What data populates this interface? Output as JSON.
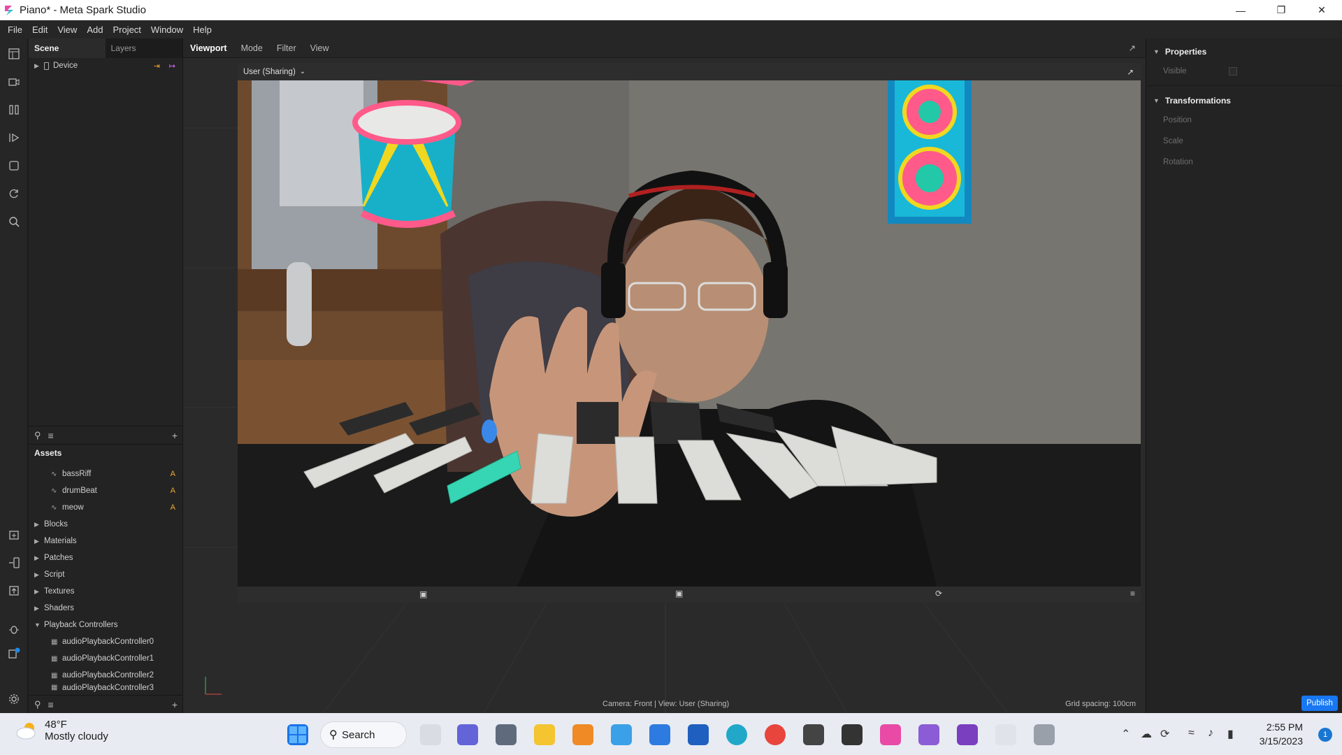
{
  "window": {
    "title": "Piano* - Meta Spark Studio"
  },
  "menu": [
    "File",
    "Edit",
    "View",
    "Add",
    "Project",
    "Window",
    "Help"
  ],
  "scene": {
    "tabs": [
      "Scene",
      "Layers"
    ],
    "tree": [
      {
        "label": "Device"
      }
    ]
  },
  "assets": {
    "title": "Assets",
    "audio": [
      {
        "label": "bassRiff",
        "badge": "A"
      },
      {
        "label": "drumBeat",
        "badge": "A"
      },
      {
        "label": "meow",
        "badge": "A"
      }
    ],
    "folders": [
      "Blocks",
      "Materials",
      "Patches",
      "Script",
      "Textures",
      "Shaders",
      "Playback Controllers"
    ],
    "controllers": [
      "audioPlaybackController0",
      "audioPlaybackController1",
      "audioPlaybackController2",
      "audioPlaybackController3"
    ]
  },
  "viewport": {
    "tabs": [
      "Viewport",
      "Mode",
      "Filter",
      "View"
    ],
    "sim_label": "User (Sharing)",
    "status_left": "Camera: Front | View: User (Sharing)",
    "status_right": "Grid spacing: 100cm"
  },
  "properties": {
    "sections": [
      "Properties",
      "Transformations"
    ],
    "visible_label": "Visible",
    "transform_labels": [
      "Position",
      "Scale",
      "Rotation"
    ],
    "publish_label": "Publish"
  },
  "taskbar": {
    "weather_temp": "48°F",
    "weather_desc": "Mostly cloudy",
    "search_label": "Search",
    "time": "2:55 PM",
    "date": "3/15/2023",
    "notification_count": "1"
  }
}
